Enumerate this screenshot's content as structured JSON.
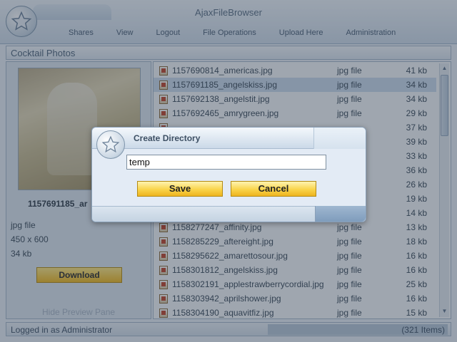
{
  "app": {
    "title": "AjaxFileBrowser",
    "menu": [
      "Shares",
      "View",
      "Logout",
      "File Operations",
      "Upload Here",
      "Administration"
    ]
  },
  "panel": {
    "title": "Cocktail Photos"
  },
  "preview": {
    "name": "1157691185_ar",
    "type": "jpg file",
    "dimensions": "450 x 600",
    "size": "34 kb",
    "download_label": "Download",
    "hide_label": "Hide Preview Pane"
  },
  "files": [
    {
      "name": "1157690814_americas.jpg",
      "type": "jpg file",
      "size": "41 kb"
    },
    {
      "name": "1157691185_angelskiss.jpg",
      "type": "jpg file",
      "size": "34 kb",
      "selected": true
    },
    {
      "name": "1157692138_angelstit.jpg",
      "type": "jpg file",
      "size": "34 kb"
    },
    {
      "name": "1157692465_amrygreen.jpg",
      "type": "jpg file",
      "size": "29 kb"
    },
    {
      "name": "",
      "type": "",
      "size": "37 kb"
    },
    {
      "name": "",
      "type": "",
      "size": "39 kb"
    },
    {
      "name": "",
      "type": "",
      "size": "33 kb"
    },
    {
      "name": "",
      "type": "",
      "size": "36 kb"
    },
    {
      "name": "",
      "type": "",
      "size": "26 kb"
    },
    {
      "name": "",
      "type": "",
      "size": "19 kb"
    },
    {
      "name": "",
      "type": "",
      "size": "14 kb"
    },
    {
      "name": "1158277247_affinity.jpg",
      "type": "jpg file",
      "size": "13 kb"
    },
    {
      "name": "1158285229_aftereight.jpg",
      "type": "jpg file",
      "size": "18 kb"
    },
    {
      "name": "1158295622_amarettosour.jpg",
      "type": "jpg file",
      "size": "16 kb"
    },
    {
      "name": "1158301812_angelskiss.jpg",
      "type": "jpg file",
      "size": "16 kb"
    },
    {
      "name": "1158302191_applestrawberrycordial.jpg",
      "type": "jpg file",
      "size": "25 kb"
    },
    {
      "name": "1158303942_aprilshower.jpg",
      "type": "jpg file",
      "size": "16 kb"
    },
    {
      "name": "1158304190_aquavitfiz.jpg",
      "type": "jpg file",
      "size": "15 kb"
    }
  ],
  "status": {
    "left": "Logged in as Administrator",
    "right": "(321 Items)"
  },
  "dialog": {
    "title": "Create Directory",
    "input_value": "temp",
    "save_label": "Save",
    "cancel_label": "Cancel"
  }
}
